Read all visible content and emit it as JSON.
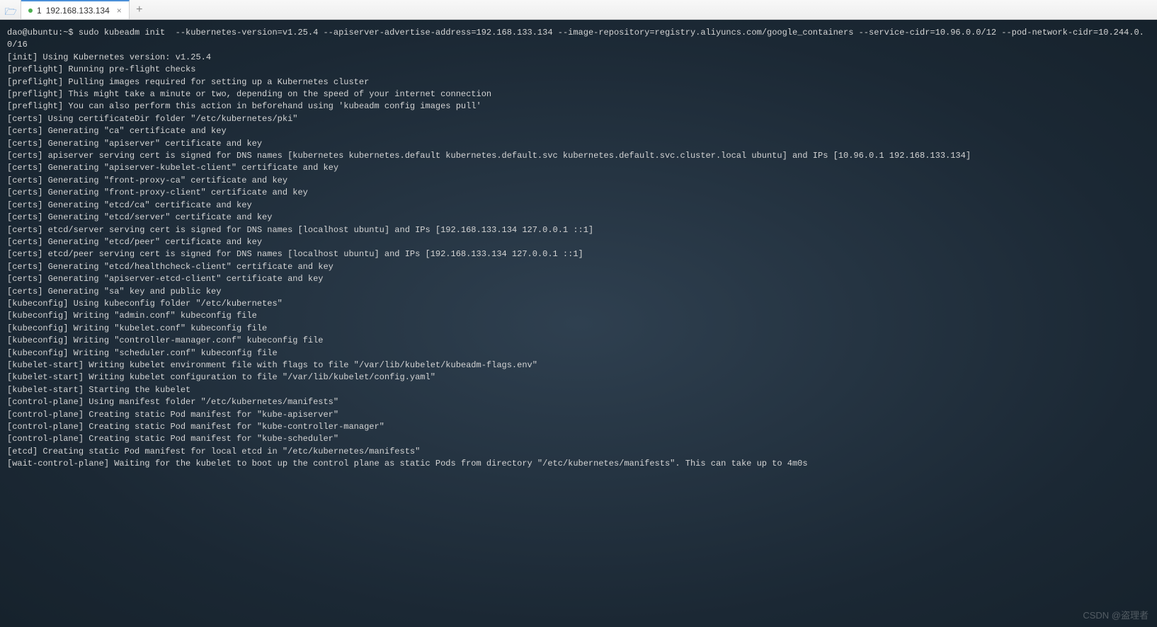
{
  "tab": {
    "number": "1",
    "title": "192.168.133.134"
  },
  "terminal": {
    "prompt": "dao@ubuntu:~$",
    "command": "sudo kubeadm init  --kubernetes-version=v1.25.4 --apiserver-advertise-address=192.168.133.134 --image-repository=registry.aliyuncs.com/google_containers --service-cidr=10.96.0.0/12 --pod-network-cidr=10.244.0.0/16",
    "lines": [
      "[init] Using Kubernetes version: v1.25.4",
      "[preflight] Running pre-flight checks",
      "[preflight] Pulling images required for setting up a Kubernetes cluster",
      "[preflight] This might take a minute or two, depending on the speed of your internet connection",
      "[preflight] You can also perform this action in beforehand using 'kubeadm config images pull'",
      "[certs] Using certificateDir folder \"/etc/kubernetes/pki\"",
      "[certs] Generating \"ca\" certificate and key",
      "[certs] Generating \"apiserver\" certificate and key",
      "[certs] apiserver serving cert is signed for DNS names [kubernetes kubernetes.default kubernetes.default.svc kubernetes.default.svc.cluster.local ubuntu] and IPs [10.96.0.1 192.168.133.134]",
      "[certs] Generating \"apiserver-kubelet-client\" certificate and key",
      "[certs] Generating \"front-proxy-ca\" certificate and key",
      "[certs] Generating \"front-proxy-client\" certificate and key",
      "[certs] Generating \"etcd/ca\" certificate and key",
      "[certs] Generating \"etcd/server\" certificate and key",
      "[certs] etcd/server serving cert is signed for DNS names [localhost ubuntu] and IPs [192.168.133.134 127.0.0.1 ::1]",
      "[certs] Generating \"etcd/peer\" certificate and key",
      "[certs] etcd/peer serving cert is signed for DNS names [localhost ubuntu] and IPs [192.168.133.134 127.0.0.1 ::1]",
      "[certs] Generating \"etcd/healthcheck-client\" certificate and key",
      "[certs] Generating \"apiserver-etcd-client\" certificate and key",
      "[certs] Generating \"sa\" key and public key",
      "[kubeconfig] Using kubeconfig folder \"/etc/kubernetes\"",
      "[kubeconfig] Writing \"admin.conf\" kubeconfig file",
      "[kubeconfig] Writing \"kubelet.conf\" kubeconfig file",
      "[kubeconfig] Writing \"controller-manager.conf\" kubeconfig file",
      "[kubeconfig] Writing \"scheduler.conf\" kubeconfig file",
      "[kubelet-start] Writing kubelet environment file with flags to file \"/var/lib/kubelet/kubeadm-flags.env\"",
      "[kubelet-start] Writing kubelet configuration to file \"/var/lib/kubelet/config.yaml\"",
      "[kubelet-start] Starting the kubelet",
      "[control-plane] Using manifest folder \"/etc/kubernetes/manifests\"",
      "[control-plane] Creating static Pod manifest for \"kube-apiserver\"",
      "[control-plane] Creating static Pod manifest for \"kube-controller-manager\"",
      "[control-plane] Creating static Pod manifest for \"kube-scheduler\"",
      "[etcd] Creating static Pod manifest for local etcd in \"/etc/kubernetes/manifests\"",
      "[wait-control-plane] Waiting for the kubelet to boot up the control plane as static Pods from directory \"/etc/kubernetes/manifests\". This can take up to 4m0s"
    ]
  },
  "watermark": "CSDN @盗理者"
}
